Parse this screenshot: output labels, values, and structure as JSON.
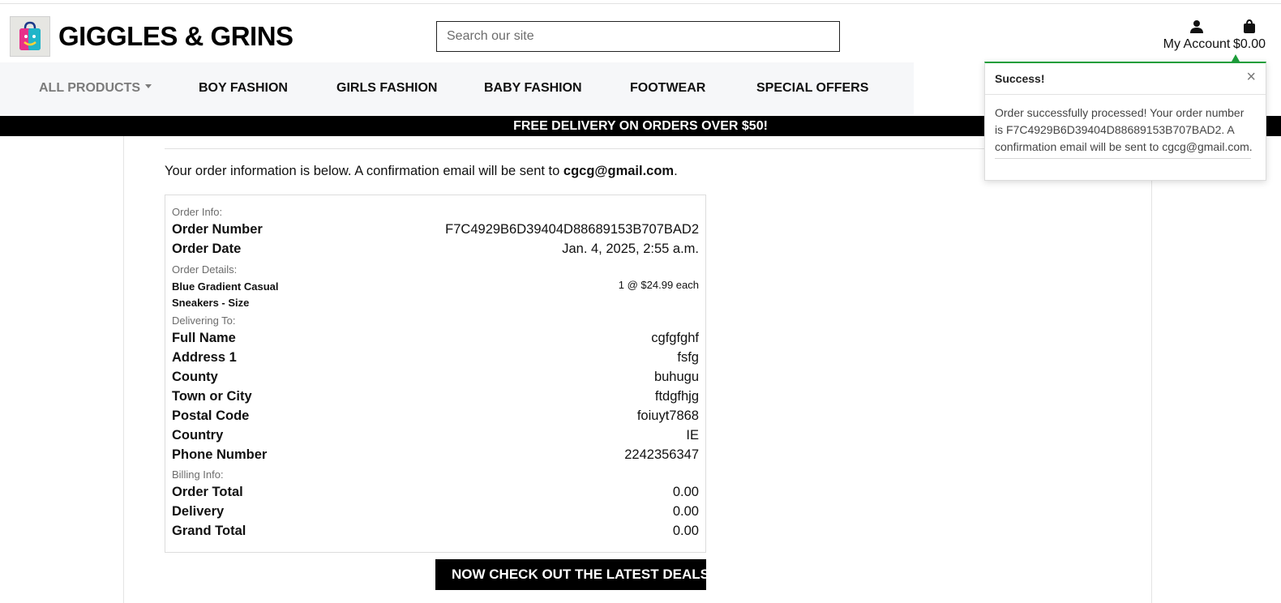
{
  "header": {
    "brand": "GIGGLES & GRINS",
    "logo_icon": "shopping-bag-smile-icon",
    "search_placeholder": "Search our site",
    "account_label": "My Account",
    "account_icon": "user-icon",
    "bag_total": "$0.00",
    "bag_icon": "shopping-bag-icon"
  },
  "nav": {
    "items": [
      {
        "label": "ALL PRODUCTS"
      },
      {
        "label": "BOY FASHION"
      },
      {
        "label": "GIRLS FASHION"
      },
      {
        "label": "BABY FASHION"
      },
      {
        "label": "FOOTWEAR"
      },
      {
        "label": "SPECIAL OFFERS"
      }
    ]
  },
  "banner": "FREE DELIVERY ON ORDERS OVER $50!",
  "intro": {
    "text": "Your order information is below. A confirmation email will be sent to ",
    "email": "cgcg@gmail.com",
    "end": "."
  },
  "order": {
    "info_heading": "Order Info:",
    "number_label": "Order Number",
    "number_value": "F7C4929B6D39404D88689153B707BAD2",
    "date_label": "Order Date",
    "date_value": "Jan. 4, 2025, 2:55 a.m.",
    "details_heading": "Order Details:",
    "item_name": "Blue Gradient Casual Sneakers - Size",
    "item_qty": "1 @ $24.99 each",
    "delivery_heading": "Delivering To:",
    "delivery": [
      {
        "label": "Full Name",
        "value": "cgfgfghf"
      },
      {
        "label": "Address 1",
        "value": "fsfg"
      },
      {
        "label": "County",
        "value": "buhugu"
      },
      {
        "label": "Town or City",
        "value": "ftdgfhjg"
      },
      {
        "label": "Postal Code",
        "value": "foiuyt7868"
      },
      {
        "label": "Country",
        "value": "IE"
      },
      {
        "label": "Phone Number",
        "value": "2242356347"
      }
    ],
    "billing_heading": "Billing Info:",
    "billing": [
      {
        "label": "Order Total",
        "value": "0.00"
      },
      {
        "label": "Delivery",
        "value": "0.00"
      },
      {
        "label": "Grand Total",
        "value": "0.00"
      }
    ]
  },
  "cta": {
    "label": "NOW CHECK OUT THE LATEST DEALS!",
    "icon": "shopping-bags-icon"
  },
  "toast": {
    "title": "Success!",
    "close": "×",
    "message": "Order successfully processed! Your order number is F7C4929B6D39404D88689153B707BAD2. A confirmation email will be sent to cgcg@gmail.com.",
    "accent": "#1e9e3b"
  }
}
